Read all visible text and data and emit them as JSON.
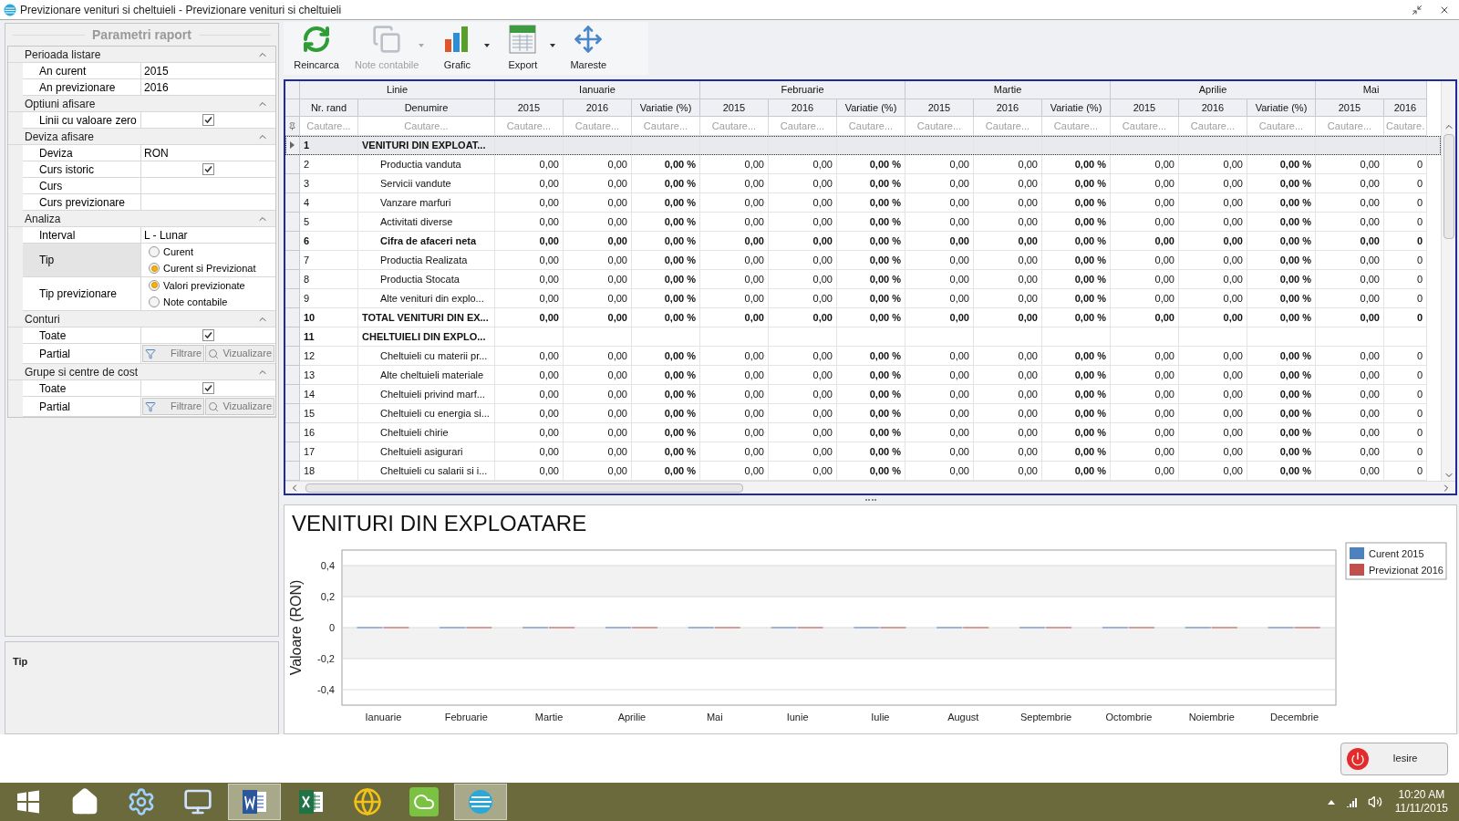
{
  "window": {
    "title": "Previzionare venituri si cheltuieli - Previzionare venituri si cheltuieli"
  },
  "params": {
    "title": "Parametri raport",
    "sections": [
      {
        "title": "Perioada listare",
        "expanded": true,
        "rows": [
          {
            "label": "An curent",
            "kind": "text",
            "value": "2015",
            "selected": false
          },
          {
            "label": "An previzionare",
            "kind": "text",
            "value": "2016",
            "selected": false
          }
        ]
      },
      {
        "title": "Optiuni afisare",
        "expanded": true,
        "rows": [
          {
            "label": "Linii cu valoare zero",
            "kind": "checkbox",
            "checked": true,
            "selected": false
          }
        ]
      },
      {
        "title": "Deviza afisare",
        "expanded": true,
        "rows": [
          {
            "label": "Deviza",
            "kind": "text",
            "value": "RON",
            "selected": false
          },
          {
            "label": "Curs istoric",
            "kind": "checkbox",
            "checked": true,
            "selected": false
          },
          {
            "label": "Curs",
            "kind": "empty",
            "selected": false
          },
          {
            "label": "Curs previzionare",
            "kind": "empty",
            "selected": false
          }
        ]
      },
      {
        "title": "Analiza",
        "expanded": true,
        "rows": [
          {
            "label": "Interval",
            "kind": "text",
            "value": "L - Lunar",
            "selected": false
          },
          {
            "label": "Tip",
            "kind": "radio",
            "selected": true,
            "options": [
              {
                "label": "Curent",
                "selected": false
              },
              {
                "label": "Curent si Previzionat",
                "selected": true
              }
            ]
          },
          {
            "label": "Tip previzionare",
            "kind": "radio",
            "selected": false,
            "options": [
              {
                "label": "Valori previzionate",
                "selected": true
              },
              {
                "label": "Note contabile",
                "selected": false
              }
            ]
          }
        ]
      },
      {
        "title": "Conturi",
        "expanded": true,
        "rows": [
          {
            "label": "Toate",
            "kind": "checkbox",
            "checked": true,
            "selected": false
          },
          {
            "label": "Partial",
            "kind": "buttons",
            "buttons": [
              "Filtrare",
              "Vizualizare"
            ],
            "selected": false
          }
        ]
      },
      {
        "title": "Grupe si centre de cost",
        "expanded": true,
        "rows": [
          {
            "label": "Toate",
            "kind": "checkbox",
            "checked": true,
            "selected": false
          },
          {
            "label": "Partial",
            "kind": "buttons",
            "buttons": [
              "Filtrare",
              "Vizualizare"
            ],
            "selected": false
          }
        ]
      }
    ]
  },
  "tip_panel": {
    "title": "Tip"
  },
  "toolbar": [
    {
      "label": "Reincarca",
      "kind": "reload",
      "disabled": false,
      "dropdown": false
    },
    {
      "label": "Note contabile",
      "kind": "notes",
      "disabled": true,
      "dropdown": true
    },
    {
      "label": "Grafic",
      "kind": "chart",
      "disabled": false,
      "dropdown": true
    },
    {
      "label": "Export",
      "kind": "export",
      "disabled": false,
      "dropdown": true
    },
    {
      "label": "Mareste",
      "kind": "maximize",
      "disabled": false,
      "dropdown": false
    }
  ],
  "grid": {
    "band": "Linie",
    "nr_header": "Nr. rand",
    "name_header": "Denumire",
    "months": [
      {
        "name": "Ianuarie",
        "columns": [
          {
            "label": "2015",
            "kind": "value"
          },
          {
            "label": "2016",
            "kind": "value"
          },
          {
            "label": "Variatie (%)",
            "kind": "variation"
          }
        ]
      },
      {
        "name": "Februarie",
        "columns": [
          {
            "label": "2015",
            "kind": "value"
          },
          {
            "label": "2016",
            "kind": "value"
          },
          {
            "label": "Variatie (%)",
            "kind": "variation"
          }
        ]
      },
      {
        "name": "Martie",
        "columns": [
          {
            "label": "2015",
            "kind": "value"
          },
          {
            "label": "2016",
            "kind": "value"
          },
          {
            "label": "Variatie (%)",
            "kind": "variation"
          }
        ]
      },
      {
        "name": "Aprilie",
        "columns": [
          {
            "label": "2015",
            "kind": "value"
          },
          {
            "label": "2016",
            "kind": "value"
          },
          {
            "label": "Variatie (%)",
            "kind": "variation"
          }
        ]
      },
      {
        "name": "Mai",
        "columns": [
          {
            "label": "2015",
            "kind": "value"
          },
          {
            "label": "2016",
            "kind": "value"
          }
        ]
      }
    ],
    "filters": [
      {
        "placeholder": "Cautare..."
      },
      {
        "placeholder": "Cautare..."
      },
      {
        "placeholder": "Cautare..."
      },
      {
        "placeholder": "Cautare..."
      },
      {
        "placeholder": "Cautare..."
      },
      {
        "placeholder": "Cautare..."
      },
      {
        "placeholder": "Cautare..."
      },
      {
        "placeholder": "Cautare..."
      },
      {
        "placeholder": "Cautare..."
      },
      {
        "placeholder": "Cautare..."
      },
      {
        "placeholder": "Cautare..."
      },
      {
        "placeholder": "Cautare..."
      },
      {
        "placeholder": "Cautare..."
      },
      {
        "placeholder": "Cautare..."
      },
      {
        "placeholder": "Cautare..."
      },
      {
        "placeholder": "Cautare."
      }
    ],
    "rows": [
      {
        "nr": "1",
        "name": "VENITURI DIN EXPLOAT...",
        "kind": "section",
        "selected": true,
        "cells": []
      },
      {
        "nr": "2",
        "name": "Productia vanduta",
        "kind": "item",
        "selected": false,
        "cells": [
          "0,00",
          "0,00",
          "0,00 %",
          "0,00",
          "0,00",
          "0,00 %",
          "0,00",
          "0,00",
          "0,00 %",
          "0,00",
          "0,00",
          "0,00 %",
          "0,00",
          "0"
        ]
      },
      {
        "nr": "3",
        "name": "Servicii vandute",
        "kind": "item",
        "selected": false,
        "cells": [
          "0,00",
          "0,00",
          "0,00 %",
          "0,00",
          "0,00",
          "0,00 %",
          "0,00",
          "0,00",
          "0,00 %",
          "0,00",
          "0,00",
          "0,00 %",
          "0,00",
          "0"
        ]
      },
      {
        "nr": "4",
        "name": "Vanzare marfuri",
        "kind": "item",
        "selected": false,
        "cells": [
          "0,00",
          "0,00",
          "0,00 %",
          "0,00",
          "0,00",
          "0,00 %",
          "0,00",
          "0,00",
          "0,00 %",
          "0,00",
          "0,00",
          "0,00 %",
          "0,00",
          "0"
        ]
      },
      {
        "nr": "5",
        "name": "Activitati diverse",
        "kind": "item",
        "selected": false,
        "cells": [
          "0,00",
          "0,00",
          "0,00 %",
          "0,00",
          "0,00",
          "0,00 %",
          "0,00",
          "0,00",
          "0,00 %",
          "0,00",
          "0,00",
          "0,00 %",
          "0,00",
          "0"
        ]
      },
      {
        "nr": "6",
        "name": "Cifra de afaceri neta",
        "kind": "subtotal",
        "selected": false,
        "cells": [
          "0,00",
          "0,00",
          "0,00 %",
          "0,00",
          "0,00",
          "0,00 %",
          "0,00",
          "0,00",
          "0,00 %",
          "0,00",
          "0,00",
          "0,00 %",
          "0,00",
          "0"
        ]
      },
      {
        "nr": "7",
        "name": "Productia Realizata",
        "kind": "item",
        "selected": false,
        "cells": [
          "0,00",
          "0,00",
          "0,00 %",
          "0,00",
          "0,00",
          "0,00 %",
          "0,00",
          "0,00",
          "0,00 %",
          "0,00",
          "0,00",
          "0,00 %",
          "0,00",
          "0"
        ]
      },
      {
        "nr": "8",
        "name": "Productia Stocata",
        "kind": "item",
        "selected": false,
        "cells": [
          "0,00",
          "0,00",
          "0,00 %",
          "0,00",
          "0,00",
          "0,00 %",
          "0,00",
          "0,00",
          "0,00 %",
          "0,00",
          "0,00",
          "0,00 %",
          "0,00",
          "0"
        ]
      },
      {
        "nr": "9",
        "name": "Alte venituri din explo...",
        "kind": "item",
        "selected": false,
        "cells": [
          "0,00",
          "0,00",
          "0,00 %",
          "0,00",
          "0,00",
          "0,00 %",
          "0,00",
          "0,00",
          "0,00 %",
          "0,00",
          "0,00",
          "0,00 %",
          "0,00",
          "0"
        ]
      },
      {
        "nr": "10",
        "name": "TOTAL VENITURI DIN EX...",
        "kind": "total",
        "selected": false,
        "cells": [
          "0,00",
          "0,00",
          "0,00 %",
          "0,00",
          "0,00",
          "0,00 %",
          "0,00",
          "0,00",
          "0,00 %",
          "0,00",
          "0,00",
          "0,00 %",
          "0,00",
          "0"
        ]
      },
      {
        "nr": "11",
        "name": "CHELTUIELI DIN EXPLO...",
        "kind": "section",
        "selected": false,
        "cells": []
      },
      {
        "nr": "12",
        "name": "Cheltuieli cu materii pr...",
        "kind": "item",
        "selected": false,
        "cells": [
          "0,00",
          "0,00",
          "0,00 %",
          "0,00",
          "0,00",
          "0,00 %",
          "0,00",
          "0,00",
          "0,00 %",
          "0,00",
          "0,00",
          "0,00 %",
          "0,00",
          "0"
        ]
      },
      {
        "nr": "13",
        "name": "Alte cheltuieli materiale",
        "kind": "item",
        "selected": false,
        "cells": [
          "0,00",
          "0,00",
          "0,00 %",
          "0,00",
          "0,00",
          "0,00 %",
          "0,00",
          "0,00",
          "0,00 %",
          "0,00",
          "0,00",
          "0,00 %",
          "0,00",
          "0"
        ]
      },
      {
        "nr": "14",
        "name": "Cheltuieli privind marf...",
        "kind": "item",
        "selected": false,
        "cells": [
          "0,00",
          "0,00",
          "0,00 %",
          "0,00",
          "0,00",
          "0,00 %",
          "0,00",
          "0,00",
          "0,00 %",
          "0,00",
          "0,00",
          "0,00 %",
          "0,00",
          "0"
        ]
      },
      {
        "nr": "15",
        "name": "Cheltuieli cu energia si...",
        "kind": "item",
        "selected": false,
        "cells": [
          "0,00",
          "0,00",
          "0,00 %",
          "0,00",
          "0,00",
          "0,00 %",
          "0,00",
          "0,00",
          "0,00 %",
          "0,00",
          "0,00",
          "0,00 %",
          "0,00",
          "0"
        ]
      },
      {
        "nr": "16",
        "name": "Cheltuieli chirie",
        "kind": "item",
        "selected": false,
        "cells": [
          "0,00",
          "0,00",
          "0,00 %",
          "0,00",
          "0,00",
          "0,00 %",
          "0,00",
          "0,00",
          "0,00 %",
          "0,00",
          "0,00",
          "0,00 %",
          "0,00",
          "0"
        ]
      },
      {
        "nr": "17",
        "name": "Cheltuieli asigurari",
        "kind": "item",
        "selected": false,
        "cells": [
          "0,00",
          "0,00",
          "0,00 %",
          "0,00",
          "0,00",
          "0,00 %",
          "0,00",
          "0,00",
          "0,00 %",
          "0,00",
          "0,00",
          "0,00 %",
          "0,00",
          "0"
        ]
      },
      {
        "nr": "18",
        "name": "Cheltuieli cu salarii si i...",
        "kind": "item",
        "selected": false,
        "cells": [
          "0,00",
          "0,00",
          "0,00 %",
          "0,00",
          "0,00",
          "0,00 %",
          "0,00",
          "0,00",
          "0,00 %",
          "0,00",
          "0,00",
          "0,00 %",
          "0,00",
          "0"
        ]
      }
    ]
  },
  "chart": {
    "chart_data": {
      "type": "bar",
      "title": "VENITURI DIN EXPLOATARE",
      "ylabel": "Valoare (RON)",
      "categories": [
        "Ianuarie",
        "Februarie",
        "Martie",
        "Aprilie",
        "Mai",
        "Iunie",
        "Iulie",
        "August",
        "Septembrie",
        "Octombrie",
        "Noiembrie",
        "Decembrie"
      ],
      "series": [
        {
          "name": "Curent 2015",
          "color": "#4f81bd",
          "values": [
            0,
            0,
            0,
            0,
            0,
            0,
            0,
            0,
            0,
            0,
            0,
            0
          ]
        },
        {
          "name": "Previzionat 2016",
          "color": "#c0504d",
          "values": [
            0,
            0,
            0,
            0,
            0,
            0,
            0,
            0,
            0,
            0,
            0,
            0
          ]
        }
      ],
      "ylim": [
        -0.5,
        0.5
      ],
      "grid": true,
      "legend": true,
      "yticks": [
        {
          "value": 0.4,
          "label": "0,4"
        },
        {
          "value": 0.2,
          "label": "0,2"
        },
        {
          "value": 0,
          "label": "0"
        },
        {
          "value": -0.2,
          "label": "-0,2"
        },
        {
          "value": -0.4,
          "label": "-0,4"
        }
      ]
    }
  },
  "exit_button": "Iesire",
  "taskbar": {
    "apps": [
      {
        "kind": "start",
        "active": false
      },
      {
        "kind": "home",
        "active": false
      },
      {
        "kind": "control-panel",
        "active": false
      },
      {
        "kind": "computer",
        "active": false
      },
      {
        "kind": "word",
        "active": true
      },
      {
        "kind": "excel",
        "active": false
      },
      {
        "kind": "browser",
        "active": false
      },
      {
        "kind": "cloud",
        "active": false
      },
      {
        "kind": "app",
        "active": true
      }
    ],
    "time": "10:20 AM",
    "date": "11/11/2015"
  }
}
